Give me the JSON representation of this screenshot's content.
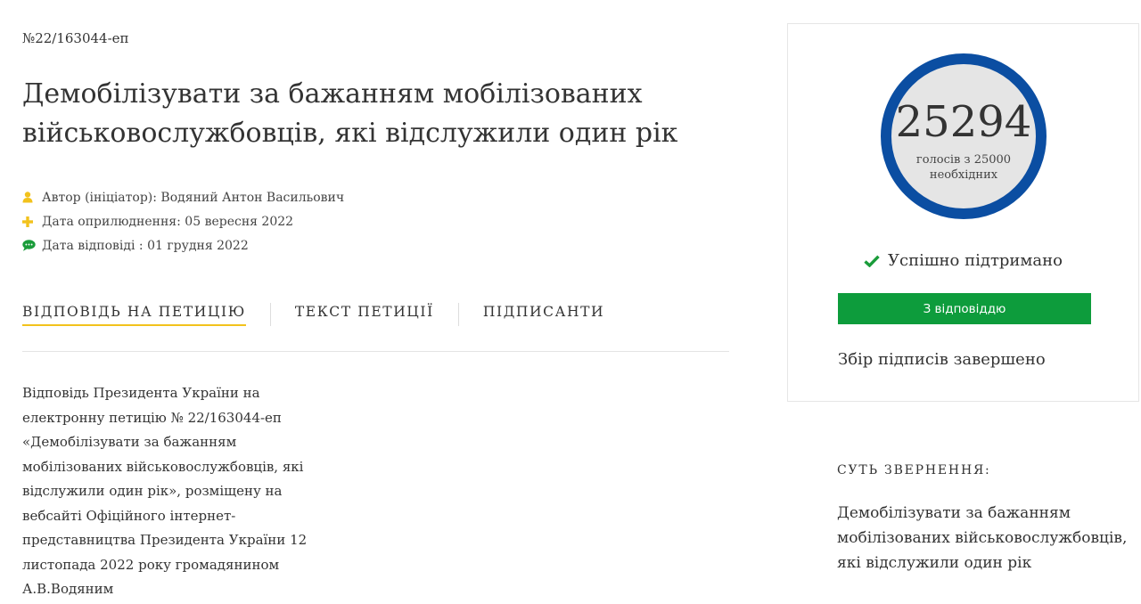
{
  "petition": {
    "number": "№22/163044-еп",
    "title": "Демобілізувати за бажанням мобілізованих військовослужбовців, які відслужили один рік",
    "meta": {
      "author": "Автор (ініціатор): Водяний Антон Васильович",
      "published": "Дата оприлюднення: 05 вересня 2022",
      "answered": "Дата відповіді : 01 грудня 2022"
    }
  },
  "tabs": [
    {
      "label": "ВІДПОВІДЬ НА ПЕТИЦІЮ",
      "active": true
    },
    {
      "label": "ТЕКСТ ПЕТИЦІЇ",
      "active": false
    },
    {
      "label": "ПІДПИСАНТИ",
      "active": false
    }
  ],
  "answer_text": "Відповідь Президента України на електронну петицію № 22/163044-еп «Демобілізувати за бажанням мобілізованих військовослужбовців, які відслужили один рік», розміщену на вебсайті Офіційного інтернет-представництва Президента України 12 листопада 2022 року громадянином А.В.Водяним",
  "sidebar": {
    "votes_count": "25294",
    "votes_label": "голосів з 25000 необхідних",
    "status": "Успішно підтримано",
    "answer_button": "З відповіддю",
    "collection_status": "Збір підписів завершено",
    "essence_heading": "СУТЬ ЗВЕРНЕННЯ:",
    "essence_text": "Демобілізувати за бажанням мобілізованих військовослужбовців, які відслужили один рік"
  },
  "icons": {
    "author": "user-icon",
    "published": "plus-icon",
    "answered": "comment-icon",
    "status": "check-icon"
  },
  "colors": {
    "counter_ring": "#0b4ea2",
    "counter_fill": "#e5e5e5",
    "success_green": "#0d9c3c",
    "icon_yellow": "#f2c21c",
    "icon_green": "#1a9c3a",
    "tab_underline": "#f2c21c"
  }
}
